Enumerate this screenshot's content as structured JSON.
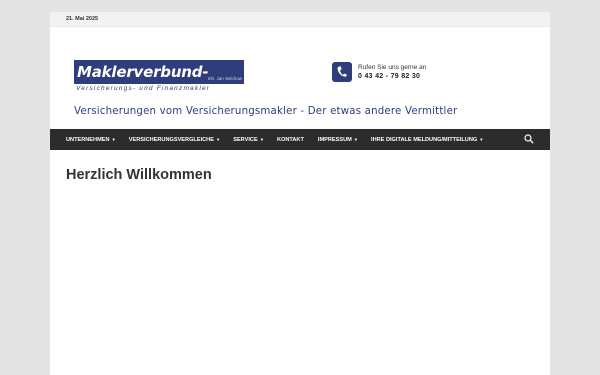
{
  "topbar": {
    "date": "21. Mai 2025"
  },
  "logo": {
    "name": "Maklerverbund-Nord",
    "owner": "Inh. Jan Selchow",
    "subtitle": "Versicherungs- und Finanzmakler"
  },
  "contact": {
    "label": "Rufen Sie uns gerne an",
    "phone": "0 43 42 - 79 82 30",
    "icon": "phone-icon"
  },
  "tagline": "Versicherungen vom Versicherungsmakler - Der etwas andere Vermittler",
  "nav": {
    "items": [
      {
        "label": "UNTERNEHMEN",
        "dropdown": "▾"
      },
      {
        "label": "VERSICHERUNGSVERGLEICHE",
        "dropdown": "▾"
      },
      {
        "label": "SERVICE",
        "dropdown": "▾"
      },
      {
        "label": "KONTAKT",
        "dropdown": ""
      },
      {
        "label": "IMPRESSUM",
        "dropdown": "▾"
      },
      {
        "label": "IHRE DIGITALE MELDUNG/MITTEILUNG",
        "dropdown": "▾"
      }
    ],
    "search_icon": "search-icon"
  },
  "main": {
    "title": "Herzlich Willkommen"
  },
  "colors": {
    "brand": "#2f3d7a",
    "nav_bg": "#2c2c2c",
    "page_bg": "#e4e4e4"
  }
}
